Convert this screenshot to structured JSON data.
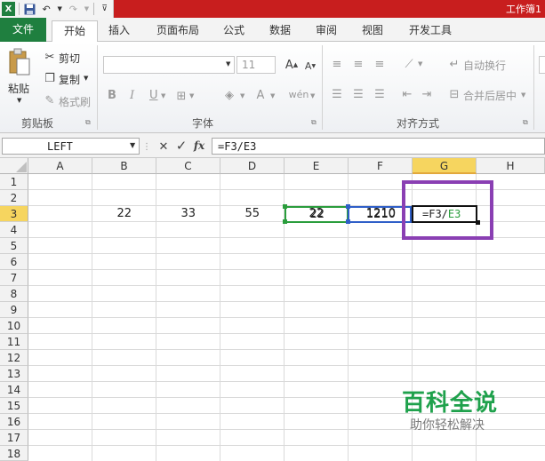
{
  "window": {
    "title": "工作簿1"
  },
  "quick_access": {
    "icons": [
      "excel-logo-icon",
      "save-icon",
      "undo-icon",
      "redo-icon",
      "customize-icon"
    ]
  },
  "tabs": [
    "文件",
    "开始",
    "插入",
    "页面布局",
    "公式",
    "数据",
    "审阅",
    "视图",
    "开发工具"
  ],
  "active_tab": "开始",
  "ribbon": {
    "clipboard": {
      "paste": "粘贴",
      "cut": "剪切",
      "copy": "复制",
      "format_painter": "格式刷",
      "label": "剪贴板"
    },
    "font": {
      "font_size": "11",
      "bold": "B",
      "italic": "I",
      "underline": "U",
      "label": "字体"
    },
    "alignment": {
      "wrap_text": "自动换行",
      "merge_center": "合并后居中",
      "label": "对齐方式"
    }
  },
  "formula_bar": {
    "name_box": "LEFT",
    "formula": "=F3/E3",
    "cancel": "✕",
    "enter": "✓",
    "fx": "fx"
  },
  "columns": [
    "A",
    "B",
    "C",
    "D",
    "E",
    "F",
    "G",
    "H"
  ],
  "rows": [
    "1",
    "2",
    "3",
    "4",
    "5",
    "6",
    "7",
    "8",
    "9",
    "10",
    "11",
    "12",
    "13",
    "14",
    "15",
    "16",
    "17",
    "18"
  ],
  "cells": {
    "B3": "22",
    "C3": "33",
    "D3": "55",
    "E3": "22",
    "F3": "1210",
    "G3_prefix": "=F3/",
    "G3_ref": "E3"
  },
  "selection": {
    "active_column": "G",
    "active_row": "3"
  },
  "colors": {
    "file_tab": "#1f7f3f",
    "titlebar": "#c81e1e",
    "highlight": "#8a3fb3",
    "ref_e3": "#2a9d3c",
    "ref_f3": "#2f5fc8"
  },
  "watermark": {
    "line1": "百科全说",
    "line2": "助你轻松解决"
  }
}
